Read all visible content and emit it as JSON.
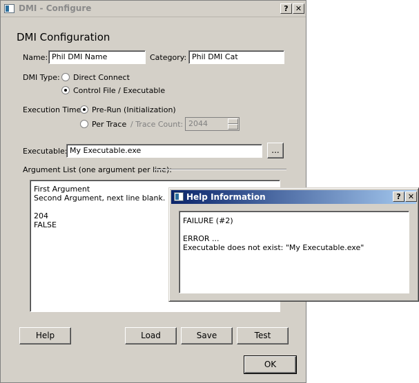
{
  "window": {
    "title": "DMI - Configure",
    "help_btn": "?",
    "close_btn": "✕"
  },
  "heading": "DMI Configuration",
  "name": {
    "label": "Name:",
    "value": "Phil DMI Name"
  },
  "category": {
    "label": "Category:",
    "value": "Phil DMI Cat"
  },
  "dmi_type": {
    "label": "DMI Type:",
    "options": [
      "Direct Connect",
      "Control File / Executable"
    ],
    "selected": "Control File / Executable"
  },
  "execution_time": {
    "label": "Execution Time:",
    "options": [
      "Pre-Run (Initialization)",
      "Per Trace"
    ],
    "selected": "Pre-Run (Initialization)",
    "trace_count_label": "/ Trace Count:",
    "trace_count_value": "2044"
  },
  "executable": {
    "label": "Executable:",
    "value": "My Executable.exe",
    "browse_label": "..."
  },
  "argument_list": {
    "label": "Argument List (one argument per line):",
    "lines": [
      "First Argument",
      "Second Argument, next line blank.",
      "",
      "204",
      "FALSE"
    ]
  },
  "buttons": {
    "help": "Help",
    "load": "Load",
    "save": "Save",
    "test": "Test",
    "ok": "OK"
  },
  "help_dialog": {
    "title": "Help Information",
    "help_btn": "?",
    "close_btn": "✕",
    "lines": [
      "FAILURE (#2)",
      "",
      "ERROR ...",
      "Executable does not exist: \"My Executable.exe\""
    ]
  }
}
